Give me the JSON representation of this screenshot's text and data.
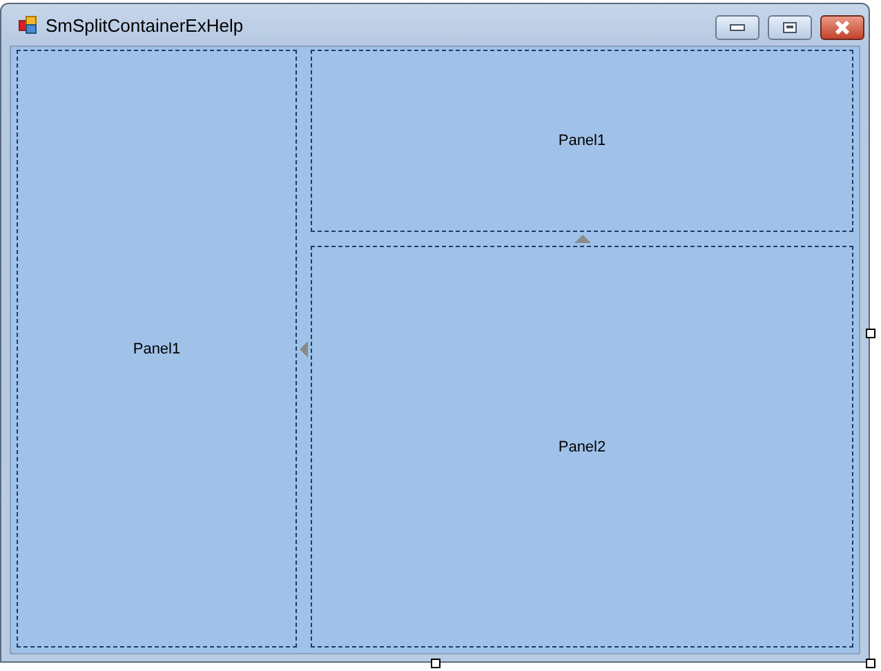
{
  "window": {
    "title": "SmSplitContainerExHelp"
  },
  "split": {
    "left_panel": {
      "label": "Panel1"
    },
    "right": {
      "top_panel": {
        "label": "Panel1"
      },
      "bottom_panel": {
        "label": "Panel2"
      }
    }
  }
}
